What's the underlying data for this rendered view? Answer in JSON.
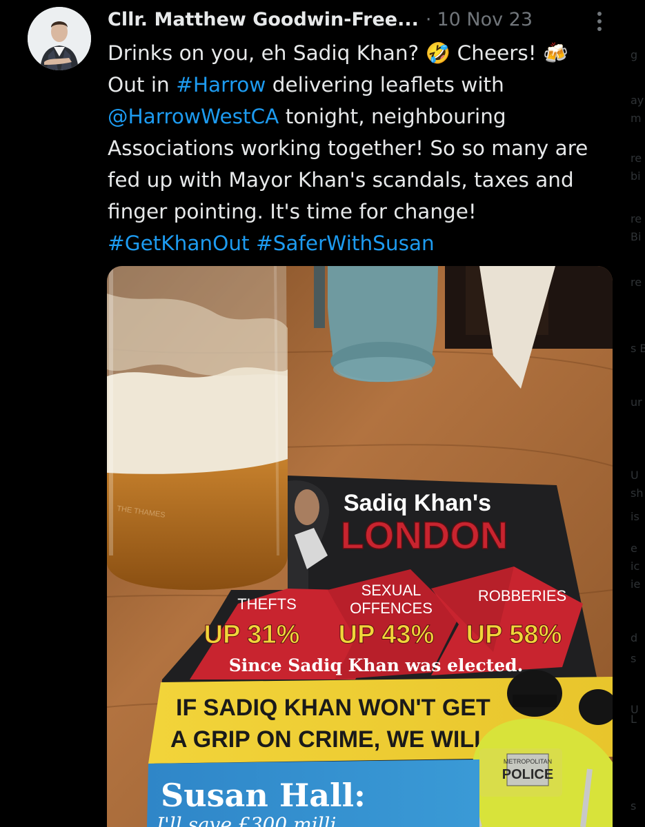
{
  "tweet": {
    "author_display_name": "Cllr. Matthew Goodwin-Free...",
    "separator": "·",
    "date": "10 Nov 23",
    "lines": [
      [
        {
          "t": "Drinks on you, eh Sadiq Khan? 🤣 Cheers! 🍻"
        }
      ],
      [
        {
          "t": "Out in "
        },
        {
          "t": "#Harrow",
          "link": true
        },
        {
          "t": " delivering leaflets with"
        }
      ],
      [
        {
          "t": "@HarrowWestCA",
          "link": true
        },
        {
          "t": " tonight, neighbouring"
        }
      ],
      [
        {
          "t": "Associations working together! So so many are"
        }
      ],
      [
        {
          "t": "fed up with Mayor Khan's scandals, taxes and"
        }
      ],
      [
        {
          "t": "finger pointing. It's time for change!"
        }
      ],
      [
        {
          "t": "#GetKhanOut",
          "link": true
        },
        {
          "t": " "
        },
        {
          "t": "#SaferWithSusan",
          "link": true
        }
      ]
    ]
  },
  "icons": {
    "more": "vertical-ellipsis-icon",
    "avatar": "profile-avatar"
  },
  "flyer": {
    "headline_top": "Sadiq Khan's",
    "headline_main": "LONDON",
    "stat1_label": "THEFTS",
    "stat1_value": "UP 31%",
    "stat2_label_line1": "SEXUAL",
    "stat2_label_line2": "OFFENCES",
    "stat2_value": "UP 43%",
    "stat3_label": "ROBBERIES",
    "stat3_value": "UP 58%",
    "since_line": "Since Sadiq Khan was elected.",
    "banner_line1": "IF SADIQ KHAN WON'T GET",
    "banner_line2": "A GRIP ON CRIME, WE WILL.",
    "candidate": "Susan Hall:",
    "bottom_partial": "I'll save £300 milli",
    "police_badge_top": "METROPOLITAN",
    "police_badge": "POLICE",
    "glass_text": "THE THAMES"
  },
  "edge_fragments": [
    "g",
    "ay",
    "m",
    "re",
    "bi",
    "re",
    "Bi",
    "re",
    "s B",
    "ur",
    "U",
    "sh",
    "is",
    "e",
    "ic",
    "ie",
    "d",
    "s",
    "U",
    "L",
    "s"
  ],
  "colors": {
    "background": "#000000",
    "text": "#e7e9ea",
    "muted": "#71767b",
    "link": "#1d9bf0",
    "flyer_red": "#c8242f",
    "flyer_yellow": "#f1d53a",
    "flyer_blue": "#2e86c8",
    "table_wood": "#a86a36"
  }
}
